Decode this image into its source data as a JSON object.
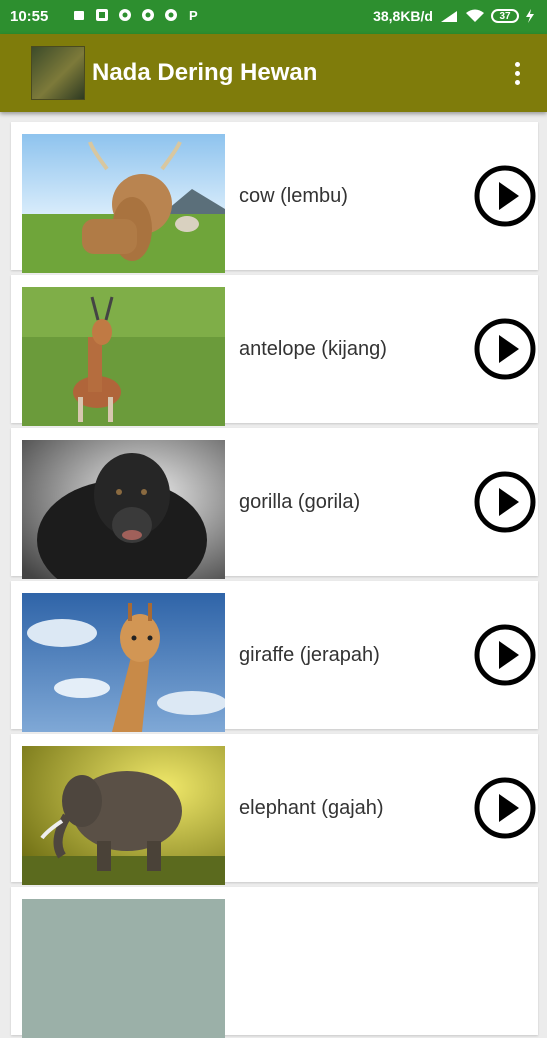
{
  "status_bar": {
    "time": "10:55",
    "network_speed": "38,8KB/d",
    "network_type": "4G",
    "battery": "37",
    "icons": [
      "notification-icon",
      "app-notification-icon",
      "chrome-icon",
      "chrome-icon",
      "chrome-icon",
      "pinterest-icon",
      "signal-icon",
      "wifi-icon",
      "battery-icon",
      "charging-icon"
    ]
  },
  "app_bar": {
    "title": "Nada Dering Hewan",
    "menu_icon": "overflow-menu-icon"
  },
  "animals": [
    {
      "label": "cow (lembu)",
      "image": "cow-photo"
    },
    {
      "label": "antelope (kijang)",
      "image": "antelope-photo"
    },
    {
      "label": "gorilla (gorila)",
      "image": "gorilla-photo"
    },
    {
      "label": "giraffe (jerapah)",
      "image": "giraffe-photo"
    },
    {
      "label": "elephant (gajah)",
      "image": "elephant-photo"
    }
  ],
  "colors": {
    "status_bar": "#2d8f2f",
    "app_bar": "#7f7c0b",
    "background": "#ececec"
  }
}
